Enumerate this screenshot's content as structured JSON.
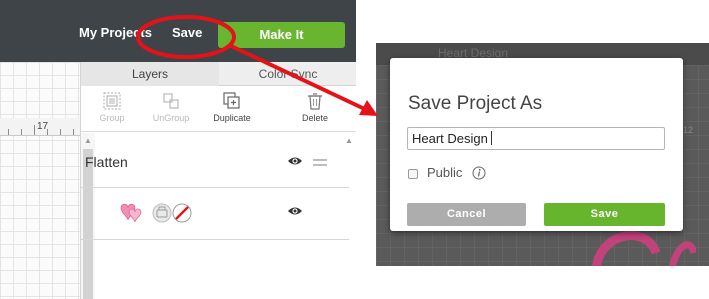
{
  "topbar": {
    "my_projects_label": "My Projects",
    "save_label": "Save",
    "make_it_label": "Make It"
  },
  "layers_panel": {
    "tabs": [
      {
        "label": "Layers"
      },
      {
        "label": "Color Sync"
      }
    ],
    "toolbar": [
      {
        "label": "Group",
        "icon": "group-icon",
        "enabled": false
      },
      {
        "label": "UnGroup",
        "icon": "ungroup-icon",
        "enabled": false
      },
      {
        "label": "Duplicate",
        "icon": "duplicate-icon",
        "enabled": true
      },
      {
        "label": "Delete",
        "icon": "trash-icon",
        "enabled": true
      }
    ],
    "layers": [
      {
        "label": "Flatten",
        "visible": true
      }
    ]
  },
  "ruler": {
    "label": "17"
  },
  "background": {
    "project_title": "Heart Design",
    "ruler_label": "12"
  },
  "dialog": {
    "title": "Save Project As",
    "name_value": "Heart Design",
    "public_label": "Public",
    "public_checked": false,
    "cancel_label": "Cancel",
    "save_label": "Save"
  },
  "colors": {
    "topbar": "#3f4448",
    "accent_green": "#6ab52f",
    "annotation_red": "#e5121a",
    "cancel_gray": "#adadad"
  }
}
